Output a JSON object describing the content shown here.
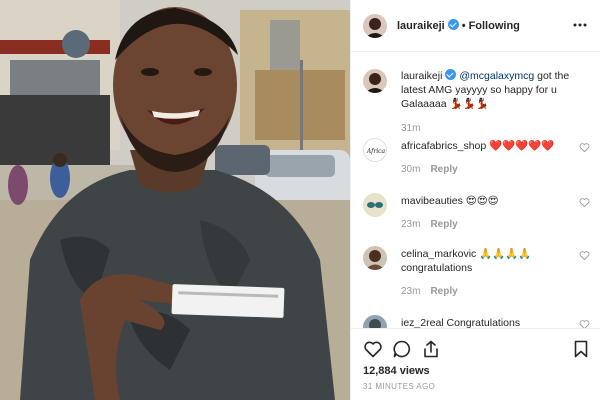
{
  "post_header": {
    "username": "lauraikeji",
    "separator": "•",
    "follow_label": "Following",
    "more_icon": "more-horizontal-icon"
  },
  "comments": [
    {
      "username": "lauraikeji",
      "verified": true,
      "mention": "@mcgalaxymcg",
      "text": " got the latest AMG yayyyy so happy for u Galaaaaa 💃🏿💃🏿💃🏿",
      "time": "31m",
      "reply_label": ""
    },
    {
      "username": "africafabrics_shop",
      "avatar_text": "Africa",
      "text": " ❤️❤️❤️❤️❤️",
      "time": "30m",
      "reply_label": "Reply"
    },
    {
      "username": "mavibeauties",
      "text": " 😍😍😍",
      "time": "23m",
      "reply_label": "Reply"
    },
    {
      "username": "celina_markovic",
      "text": " 🙏🙏🙏🙏 congratulations",
      "time": "23m",
      "reply_label": "Reply"
    },
    {
      "username": "iez_2real",
      "text": " Congratulations",
      "time": "",
      "reply_label": ""
    }
  ],
  "actions": {
    "like_icon": "heart-icon",
    "comment_icon": "comment-icon",
    "share_icon": "share-icon",
    "save_icon": "bookmark-icon"
  },
  "views": "12,884 views",
  "time_ago": "31 MINUTES AGO",
  "colors": {
    "verified": "#3897f0",
    "mention": "#003569",
    "muted_text": "#999999",
    "border": "#efefef"
  }
}
